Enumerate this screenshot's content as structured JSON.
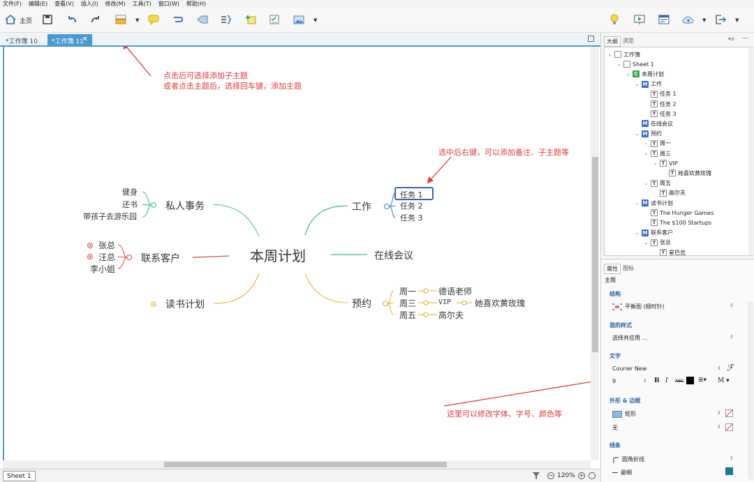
{
  "menubar": [
    "文件(F)",
    "编辑(E)",
    "查看(V)",
    "插入(I)",
    "修改(M)",
    "工具(T)",
    "窗口(W)",
    "帮助(H)"
  ],
  "toolbar": {
    "home_label": "主页"
  },
  "tabs": [
    {
      "label": "*工作簿 10"
    },
    {
      "label": "*工作簿 11"
    }
  ],
  "tab_close": "×",
  "mindmap": {
    "central": "本周计划",
    "branches": {
      "work": {
        "label": "工作",
        "children": [
          "任务 1",
          "任务 2",
          "任务 3"
        ]
      },
      "meeting": {
        "label": "在线会议"
      },
      "appointments": {
        "label": "预约",
        "children": [
          {
            "label": "周一",
            "child": "德语老师"
          },
          {
            "label": "周三",
            "child": "VIP",
            "grandchild": "她喜欢黄玫瑰"
          },
          {
            "label": "周五",
            "child": "高尔夫"
          }
        ]
      },
      "personal": {
        "label": "私人事务",
        "children": [
          "健身",
          "还书",
          "带孩子去游乐园"
        ]
      },
      "contacts": {
        "label": "联系客户",
        "children": [
          "张总",
          "汪总",
          "李小姐"
        ]
      },
      "reading": {
        "label": "读书计划"
      }
    }
  },
  "annotations": {
    "add_subtopic_1": "点击后可选择添加子主题",
    "add_subtopic_2": "或者点击主题后，选择回车键，添加主题",
    "right_click": "选中后右键，可以添加备注、子主题等",
    "modify_font": "这里可以修改字体、字号、颜色等"
  },
  "statusbar": {
    "sheet": "Sheet 1",
    "zoom": "120%"
  },
  "right_panel": {
    "tabs": [
      "大纲",
      "浏览"
    ],
    "tree": [
      {
        "label": "工作簿",
        "indent": 0,
        "icon": "doc",
        "twisty": "v"
      },
      {
        "label": "Sheet 1",
        "indent": 1,
        "icon": "doc",
        "twisty": "v"
      },
      {
        "label": "本周计划",
        "indent": 2,
        "icon": "C",
        "twisty": "v"
      },
      {
        "label": "工作",
        "indent": 3,
        "icon": "M",
        "twisty": "v"
      },
      {
        "label": "任务 1",
        "indent": 4,
        "icon": "T",
        "twisty": ""
      },
      {
        "label": "任务 2",
        "indent": 4,
        "icon": "T",
        "twisty": ""
      },
      {
        "label": "任务 3",
        "indent": 4,
        "icon": "T",
        "twisty": ""
      },
      {
        "label": "在线会议",
        "indent": 3,
        "icon": "M",
        "twisty": ""
      },
      {
        "label": "预约",
        "indent": 3,
        "icon": "M",
        "twisty": "v"
      },
      {
        "label": "周一",
        "indent": 4,
        "icon": "T",
        "twisty": ">"
      },
      {
        "label": "周三",
        "indent": 4,
        "icon": "T",
        "twisty": "v"
      },
      {
        "label": "VIP",
        "indent": 5,
        "icon": "T",
        "twisty": "v"
      },
      {
        "label": "她喜欢黄玫瑰",
        "indent": 6,
        "icon": "T",
        "twisty": ""
      },
      {
        "label": "周五",
        "indent": 4,
        "icon": "T",
        "twisty": "v"
      },
      {
        "label": "高尔夫",
        "indent": 5,
        "icon": "T",
        "twisty": ""
      },
      {
        "label": "读书计划",
        "indent": 3,
        "icon": "M",
        "twisty": "v"
      },
      {
        "label": "The Hunger Games",
        "indent": 4,
        "icon": "T",
        "twisty": ""
      },
      {
        "label": "The $100 Startups",
        "indent": 4,
        "icon": "T",
        "twisty": ""
      },
      {
        "label": "联系客户",
        "indent": 3,
        "icon": "M",
        "twisty": "v"
      },
      {
        "label": "张总",
        "indent": 4,
        "icon": "T",
        "twisty": "v"
      },
      {
        "label": "星巴克",
        "indent": 5,
        "icon": "T",
        "twisty": ""
      }
    ],
    "props_tabs": [
      "属性",
      "图标"
    ],
    "props_title": "主题",
    "structure": {
      "heading": "结构",
      "value": "平衡图 (顺时针)"
    },
    "style": {
      "heading": "我的样式",
      "value": "选择并应用 ..."
    },
    "text": {
      "heading": "文字",
      "font": "Courier New",
      "size": "9",
      "bold": "B",
      "italic": "I",
      "strike": "ABC",
      "align_sym": "M"
    },
    "shape": {
      "heading": "外形 & 边框",
      "shape": "矩形",
      "border": "无"
    },
    "line": {
      "heading": "线条",
      "style": "圆角折线",
      "width": "最细"
    }
  },
  "colors": {
    "accent": "#4a9ad0",
    "annotation": "#e23a3a",
    "selected_border": "#3b5fc2"
  }
}
